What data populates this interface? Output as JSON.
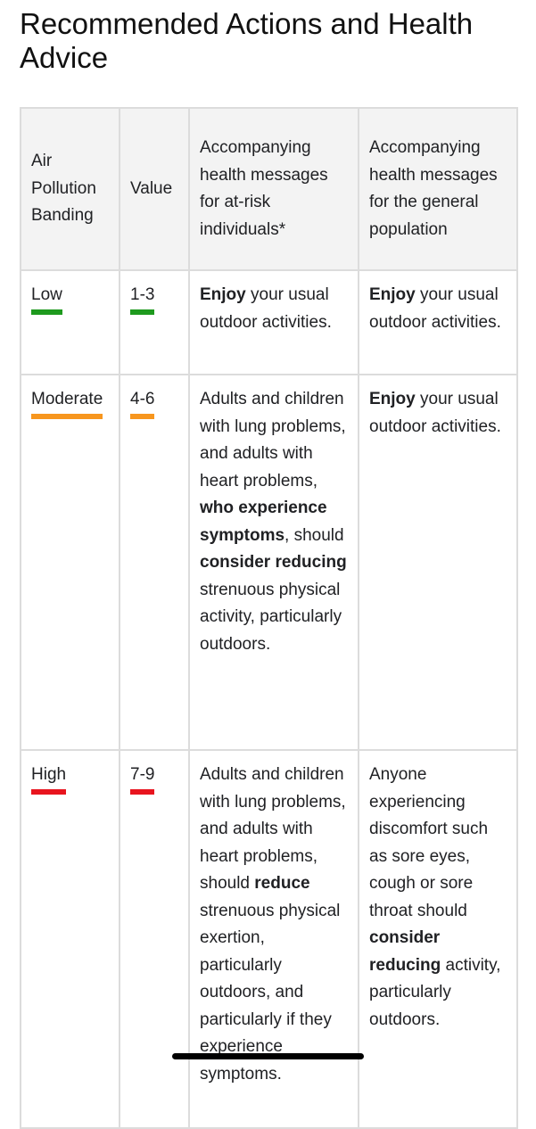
{
  "title": "Recommended Actions and Health Advice",
  "table": {
    "headers": [
      "Air Pollution Banding",
      "Value",
      "Accompanying health messages for at-risk individuals*",
      "Accompanying health messages for the general population"
    ],
    "rows": [
      {
        "band": "Low",
        "value": "1-3",
        "color": "#1e9a1e",
        "at_risk": [
          {
            "t": "Enjoy",
            "b": true
          },
          {
            "t": " your usual outdoor activities.",
            "b": false
          }
        ],
        "general": [
          {
            "t": "Enjoy",
            "b": true
          },
          {
            "t": " your usual outdoor activities.",
            "b": false
          }
        ]
      },
      {
        "band": "Moderate",
        "value": "4-6",
        "color": "#f7961e",
        "at_risk": [
          {
            "t": "Adults and children with lung problems, and adults with heart problems, ",
            "b": false
          },
          {
            "t": "who experience symptoms",
            "b": true
          },
          {
            "t": ", should ",
            "b": false
          },
          {
            "t": "consider reducing",
            "b": true
          },
          {
            "t": " strenuous physical activity, particularly outdoors.",
            "b": false
          }
        ],
        "general": [
          {
            "t": "Enjoy",
            "b": true
          },
          {
            "t": " your usual outdoor activities.",
            "b": false
          }
        ]
      },
      {
        "band": "High",
        "value": "7-9",
        "color": "#e8141e",
        "at_risk": [
          {
            "t": "Adults and children with lung problems, and adults with heart problems, should ",
            "b": false
          },
          {
            "t": "reduce",
            "b": true
          },
          {
            "t": " strenuous physical exertion, particularly outdoors, and particularly if they experience symptoms.",
            "b": false
          }
        ],
        "general": [
          {
            "t": "Anyone experiencing discomfort such as sore eyes, cough or sore throat should ",
            "b": false
          },
          {
            "t": "consider reducing",
            "b": true
          },
          {
            "t": " activity, particularly outdoors.",
            "b": false
          }
        ]
      }
    ]
  }
}
